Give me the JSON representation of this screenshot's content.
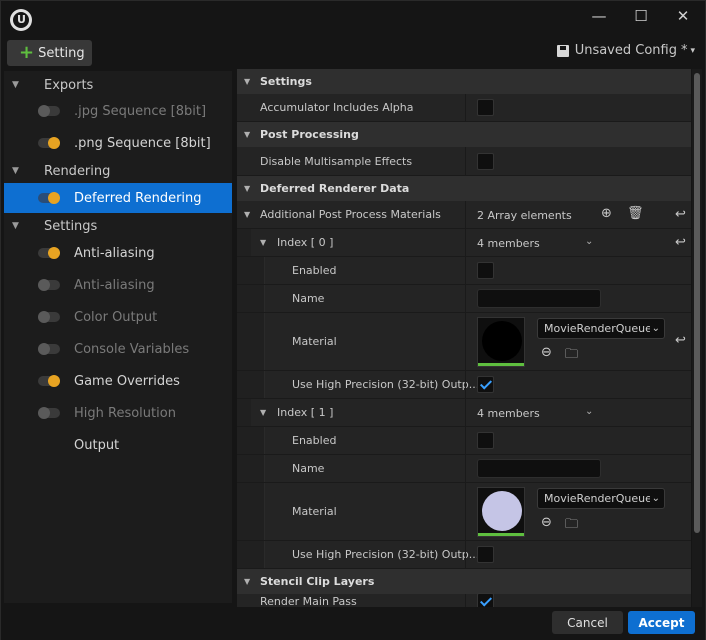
{
  "window": {
    "logo_letter": "U",
    "minimize": "—",
    "maximize": "☐",
    "close": "✕"
  },
  "toolbar": {
    "setting_button": "Setting",
    "config_label": "Unsaved Config",
    "config_modified": "*",
    "config_caret": "▾"
  },
  "sidebar": {
    "cat_exports": "Exports",
    "jpg": ".jpg Sequence [8bit]",
    "png": ".png Sequence [8bit]",
    "cat_rendering": "Rendering",
    "deferred": "Deferred Rendering",
    "cat_settings": "Settings",
    "aa1": "Anti-aliasing",
    "aa2": "Anti-aliasing",
    "color_output": "Color Output",
    "console_vars": "Console Variables",
    "game_overrides": "Game Overrides",
    "high_res": "High Resolution",
    "output": "Output"
  },
  "details": {
    "sec_settings": "Settings",
    "accum_alpha": "Accumulator Includes Alpha",
    "sec_post": "Post Processing",
    "disable_msaa": "Disable Multisample Effects",
    "sec_deferred": "Deferred Renderer Data",
    "addl_ppm": "Additional Post Process Materials",
    "array_elements": "2 Array elements",
    "index0_label": "Index",
    "index0_value": "[ 0 ]",
    "members0": "4 members",
    "enabled0": "Enabled",
    "name0": "Name",
    "material0": "Material",
    "material0_combo": "MovieRenderQueue",
    "highprec0": "Use High Precision (32-bit) Outp...",
    "index1_label": "Index",
    "index1_value": "[ 1 ]",
    "members1": "4 members",
    "enabled1": "Enabled",
    "name1": "Name",
    "material1": "Material",
    "material1_combo": "MovieRenderQueue",
    "highprec1": "Use High Precision (32-bit) Outp...",
    "sec_stencil": "Stencil Clip Layers",
    "render_main_pass": "Render Main Pass"
  },
  "footer": {
    "cancel": "Cancel",
    "accept": "Accept"
  },
  "colors": {
    "accent": "#0e6fd1",
    "toggle_on": "#e7a322",
    "plus": "#5fbf3f"
  }
}
